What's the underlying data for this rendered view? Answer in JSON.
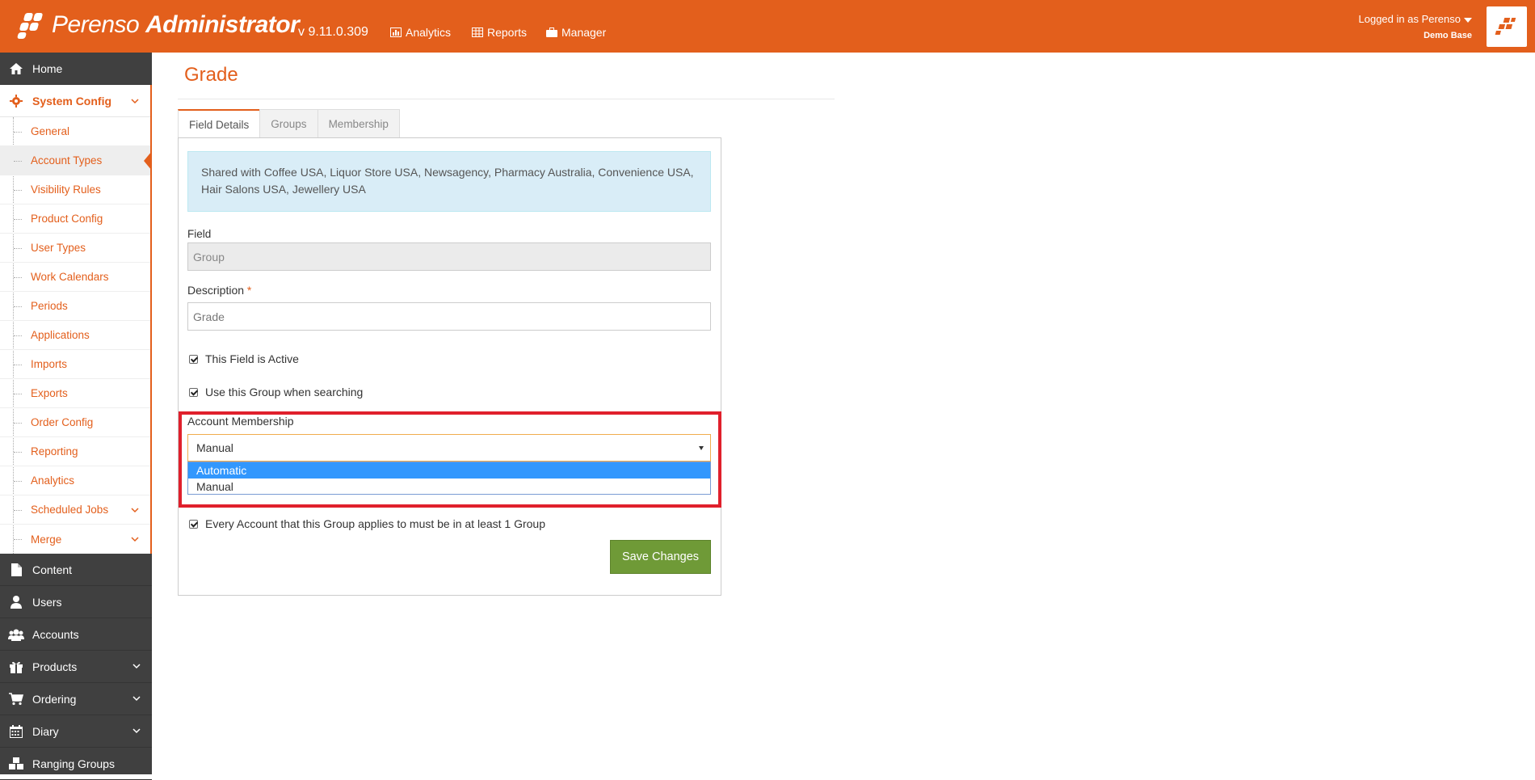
{
  "header": {
    "brand_light": "Perenso",
    "brand_bold": "Administrator",
    "version": "v 9.11.0.309",
    "nav": [
      {
        "label": "Analytics",
        "icon": "chart-icon"
      },
      {
        "label": "Reports",
        "icon": "table-icon"
      },
      {
        "label": "Manager",
        "icon": "briefcase-icon"
      }
    ],
    "user": {
      "logged_in": "Logged in as Perenso",
      "database": "Demo Base"
    }
  },
  "sidebar": {
    "home": "Home",
    "system_config": "System Config",
    "config_items": [
      "General",
      "Account Types",
      "Visibility Rules",
      "Product Config",
      "User Types",
      "Work Calendars",
      "Periods",
      "Applications",
      "Imports",
      "Exports",
      "Order Config",
      "Reporting",
      "Analytics",
      "Scheduled Jobs",
      "Merge"
    ],
    "bottom_items": [
      "Content",
      "Users",
      "Accounts",
      "Products",
      "Ordering",
      "Diary",
      "Ranging Groups"
    ]
  },
  "main": {
    "title": "Grade",
    "tabs": [
      "Field Details",
      "Groups",
      "Membership"
    ],
    "info": "Shared with Coffee USA, Liquor Store USA, Newsagency, Pharmacy Australia, Convenience USA, Hair Salons USA, Jewellery USA",
    "field_label": "Field",
    "field_value": "Group",
    "description_label": "Description",
    "required_mark": "*",
    "description_value": "Grade",
    "check_active": "This Field is Active",
    "check_search": "Use this Group when searching",
    "membership_label": "Account Membership",
    "membership_value": "Manual",
    "membership_options": [
      "Automatic",
      "Manual"
    ],
    "check_every": "Every Account that this Group applies to must be in at least 1 Group",
    "save_label": "Save Changes"
  },
  "colors": {
    "brand": "#e35f1c",
    "sidebar": "#404040",
    "save": "#6f9a37",
    "highlight": "#e0202c",
    "info_bg": "#d9edf7",
    "option_selected": "#3297fd"
  }
}
